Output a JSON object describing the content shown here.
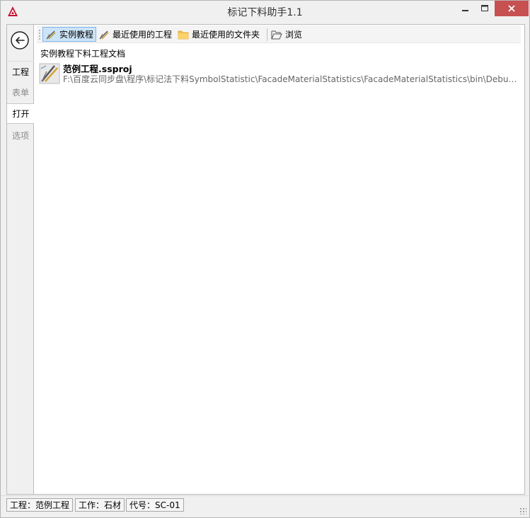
{
  "window": {
    "title": "标记下料助手1.1"
  },
  "sidebar": {
    "tabs": [
      {
        "label": "工程",
        "state": "normal"
      },
      {
        "label": "表单",
        "state": "disabled"
      },
      {
        "label": "打开",
        "state": "selected"
      },
      {
        "label": "选项",
        "state": "disabled"
      }
    ]
  },
  "toolbar": {
    "items": [
      {
        "label": "实例教程",
        "icon": "drafting-tools-icon",
        "active": true
      },
      {
        "label": "最近使用的工程",
        "icon": "drafting-tools-icon",
        "active": false
      },
      {
        "label": "最近使用的文件夹",
        "icon": "folder-icon",
        "active": false
      },
      {
        "label": "浏览",
        "icon": "open-folder-icon",
        "active": false
      }
    ]
  },
  "main": {
    "section_label": "实例教程下料工程文档",
    "files": [
      {
        "name": "范例工程.ssproj",
        "path": "F:\\百度云同步盘\\程序\\标记法下料SymbolStatistic\\FacadeMaterialStatistics\\FacadeMaterialStatistics\\bin\\Debug\\Samples\\范例工程.ssproj"
      }
    ]
  },
  "statusbar": {
    "project": "工程：范例工程",
    "work": "工作：石材",
    "code": "代号：SC-01"
  },
  "colors": {
    "accent": "#cce4f7",
    "close": "#c75050"
  }
}
